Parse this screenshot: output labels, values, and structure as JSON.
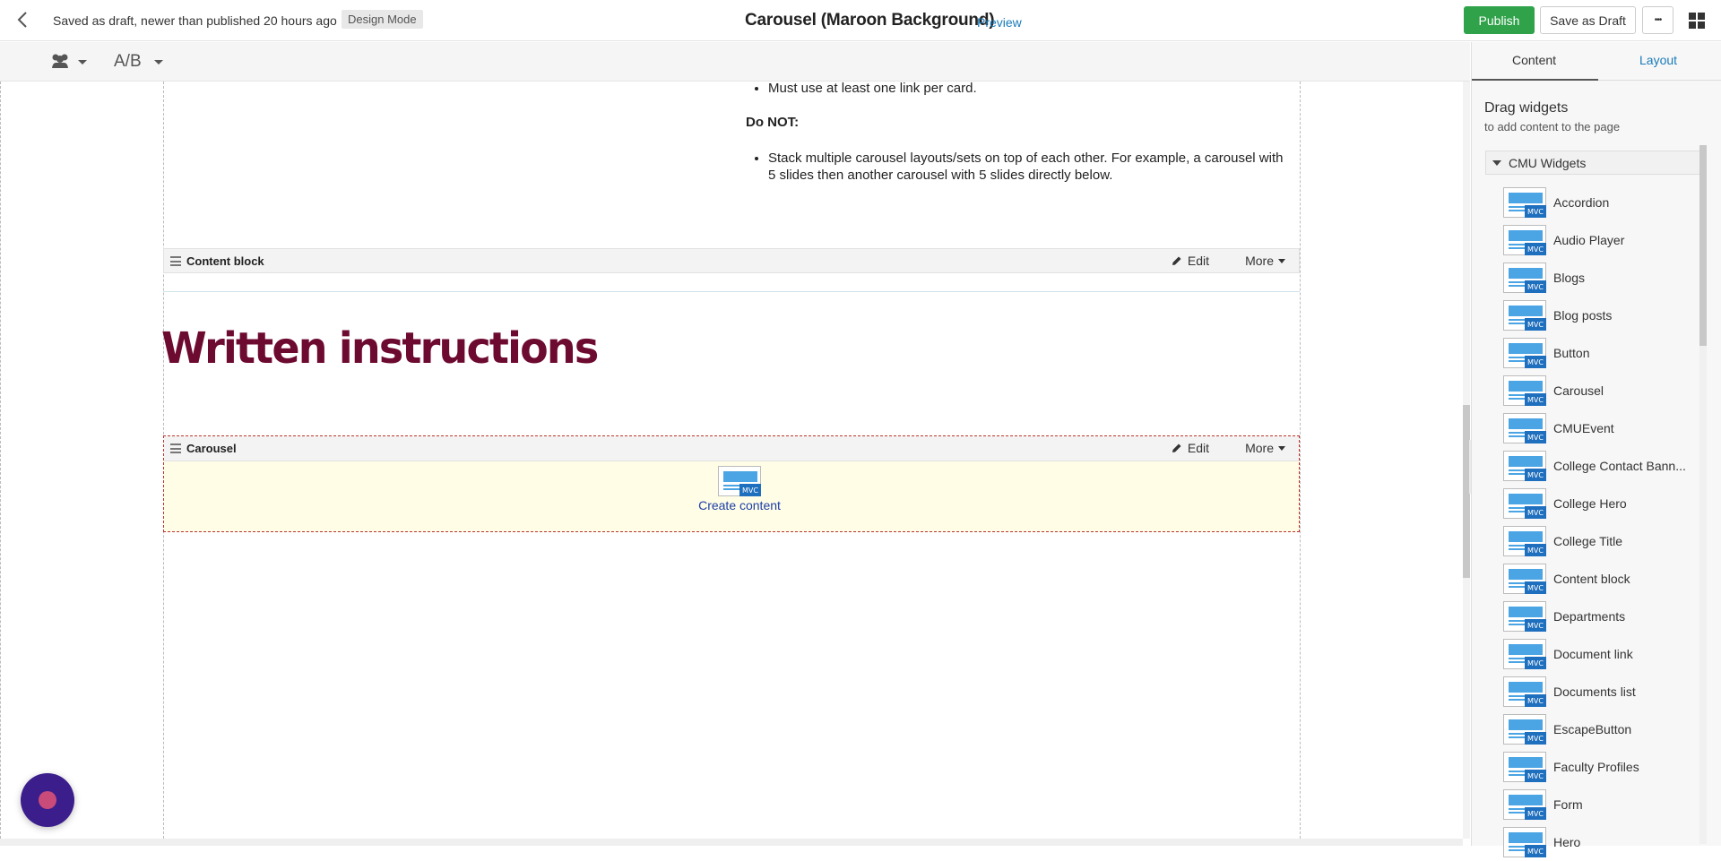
{
  "topbar": {
    "status": "Saved as draft, newer than published 20 hours ago",
    "mode_badge": "Design Mode",
    "title": "Carousel (Maroon Background)",
    "preview": "Preview",
    "publish": "Publish",
    "save_draft": "Save as Draft",
    "more": "•••"
  },
  "toolbar": {
    "ab_label": "A/B"
  },
  "canvas": {
    "bullets_top": [
      "Must use at least one link per card."
    ],
    "do_not": "Do NOT:",
    "bullets_bottom": [
      "Stack multiple carousel layouts/sets on top of each other. For example, a carousel with 5 slides then another carousel with 5 slides directly below."
    ],
    "content_block": {
      "title": "Content block",
      "edit": "Edit",
      "more": "More"
    },
    "heading": "Written instructions",
    "carousel": {
      "title": "Carousel",
      "edit": "Edit",
      "more": "More",
      "create": "Create content",
      "mvc": "MVC"
    }
  },
  "panel": {
    "tabs": [
      "Content",
      "Layout"
    ],
    "drag_title": "Drag widgets",
    "drag_sub": "to add content to the page",
    "group": "CMU Widgets",
    "mvc_badge": "MVC",
    "widgets": [
      "Accordion",
      "Audio Player",
      "Blogs",
      "Blog posts",
      "Button",
      "Carousel",
      "CMUEvent",
      "College Contact Bann...",
      "College Hero",
      "College Title",
      "Content block",
      "Departments",
      "Document link",
      "Documents list",
      "EscapeButton",
      "Faculty Profiles",
      "Form",
      "Hero"
    ]
  },
  "colors": {
    "publish": "#2fa24a",
    "heading": "#6d0a30",
    "link": "#1a7bb9",
    "carousel_bg": "#fffde6"
  }
}
